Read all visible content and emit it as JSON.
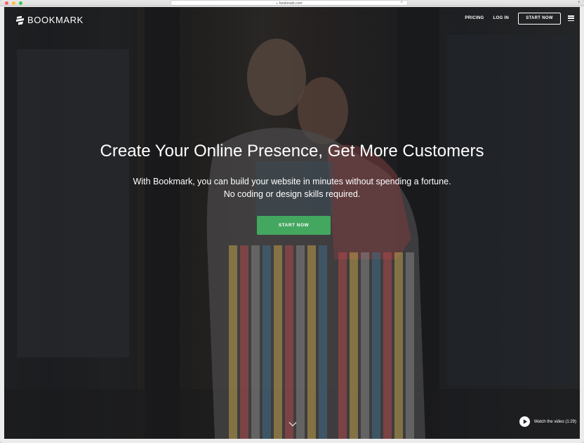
{
  "browser": {
    "url": "bookmark.com"
  },
  "header": {
    "logo_text": "BOOKMARK",
    "nav": {
      "pricing": "PRICING",
      "login": "LOG IN",
      "start": "START NOW"
    }
  },
  "hero": {
    "title": "Create Your Online Presence, Get More Customers",
    "subtitle_line1": "With Bookmark, you can build your website in minutes without spending a fortune.",
    "subtitle_line2": "No coding or design skills required.",
    "cta": "START NOW"
  },
  "video": {
    "label": "Watch the video (1:29)"
  },
  "colors": {
    "accent": "#43a760",
    "overlay": "#141414"
  }
}
